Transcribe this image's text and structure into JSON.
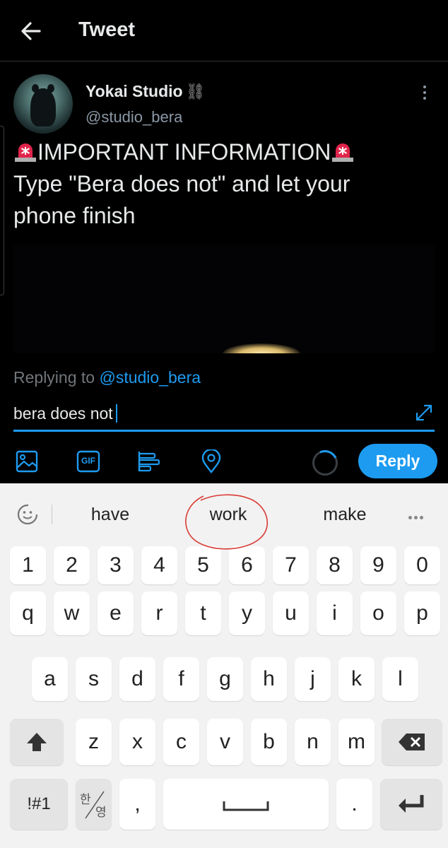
{
  "header": {
    "title": "Tweet"
  },
  "tweet": {
    "display_name": "Yokai Studio",
    "name_emoji": "⛓",
    "handle": "@studio_bera",
    "line1_text": "IMPORTANT INFORMATION",
    "line2_text": "Type \"Bera does not\" and let your",
    "line3_text": "phone finish"
  },
  "reply": {
    "replying_prefix": "Replying to",
    "replying_handle": "@studio_bera",
    "compose_value": "bera does not",
    "reply_button": "Reply",
    "toolbar_icons": [
      "image-icon",
      "gif-icon",
      "poll-icon",
      "location-icon"
    ],
    "gif_label": "GIF"
  },
  "keyboard": {
    "suggestions": [
      "have",
      "work",
      "make"
    ],
    "row_numbers": [
      "1",
      "2",
      "3",
      "4",
      "5",
      "6",
      "7",
      "8",
      "9",
      "0"
    ],
    "row1": [
      "q",
      "w",
      "e",
      "r",
      "t",
      "y",
      "u",
      "i",
      "o",
      "p"
    ],
    "row2": [
      "a",
      "s",
      "d",
      "f",
      "g",
      "h",
      "j",
      "k",
      "l"
    ],
    "row3": [
      "z",
      "x",
      "c",
      "v",
      "b",
      "n",
      "m"
    ],
    "symbols_key": "!#1",
    "lang_key_top": "한",
    "lang_key_bottom": "영",
    "comma_key": ",",
    "period_key": "."
  },
  "colors": {
    "accent": "#1d9bf0",
    "background": "#000000",
    "keyboard_bg": "#f2f2f2",
    "annotation": "#d93b35"
  }
}
